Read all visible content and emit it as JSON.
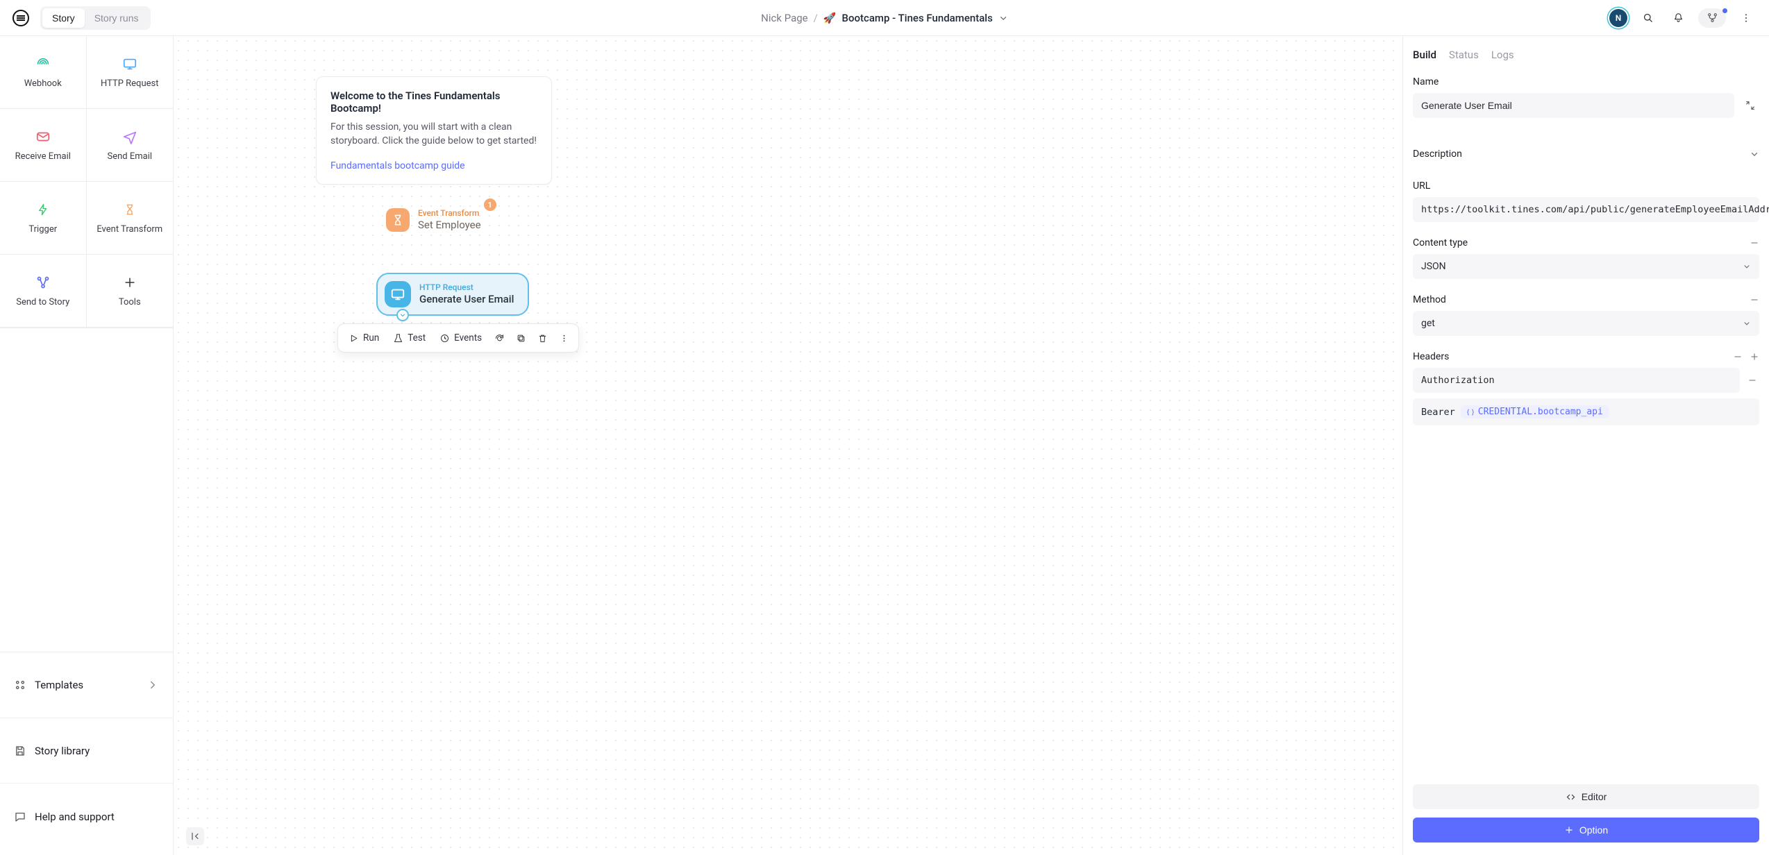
{
  "topbar": {
    "segment": {
      "story": "Story",
      "runs": "Story runs"
    },
    "breadcrumb": {
      "user": "Nick Page",
      "emoji": "🚀",
      "title": "Bootcamp - Tines Fundamentals"
    },
    "avatar_initial": "N"
  },
  "palette": {
    "webhook": "Webhook",
    "http": "HTTP Request",
    "receive_email": "Receive Email",
    "send_email": "Send Email",
    "trigger": "Trigger",
    "event_transform": "Event Transform",
    "send_to_story": "Send to Story",
    "tools": "Tools"
  },
  "nav": {
    "templates": "Templates",
    "library": "Story library",
    "help": "Help and support"
  },
  "welcome": {
    "title": "Welcome to the Tines Fundamentals Bootcamp!",
    "body": "For this session, you will start with a clean storyboard. Click the guide below to get started!",
    "link": "Fundamentals bootcamp guide"
  },
  "nodes": {
    "set_employee": {
      "type": "Event Transform",
      "name": "Set Employee",
      "badge": "1"
    },
    "generate": {
      "type": "HTTP Request",
      "name": "Generate User Email"
    }
  },
  "node_toolbar": {
    "run": "Run",
    "test": "Test",
    "events": "Events"
  },
  "panel": {
    "tabs": {
      "build": "Build",
      "status": "Status",
      "logs": "Logs"
    },
    "name_label": "Name",
    "name_value": "Generate User Email",
    "description_label": "Description",
    "url_label": "URL",
    "url_value": "https://toolkit.tines.com/api/public/generateEmployeeEmailAddress",
    "content_type_label": "Content type",
    "content_type_value": "JSON",
    "method_label": "Method",
    "method_value": "get",
    "headers_label": "Headers",
    "header_key": "Authorization",
    "header_value_prefix": "Bearer",
    "header_token": "CREDENTIAL.bootcamp_api",
    "editor_btn": "Editor",
    "option_btn": "Option"
  }
}
